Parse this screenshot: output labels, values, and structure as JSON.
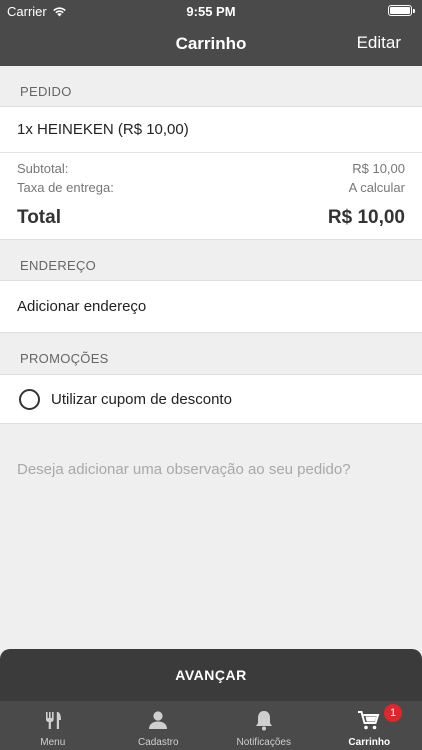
{
  "status_bar": {
    "carrier": "Carrier",
    "time": "9:55 PM"
  },
  "nav": {
    "title": "Carrinho",
    "edit_label": "Editar"
  },
  "order": {
    "header": "PEDIDO",
    "item": "1x HEINEKEN  (R$ 10,00)",
    "subtotal_label": "Subtotal:",
    "subtotal_value": "R$ 10,00",
    "delivery_label": "Taxa de entrega:",
    "delivery_value": "A calcular",
    "total_label": "Total",
    "total_value": "R$ 10,00"
  },
  "address": {
    "header": "ENDEREÇO",
    "add_label": "Adicionar endereço"
  },
  "promotions": {
    "header": "PROMOÇÕES",
    "coupon_label": "Utilizar cupom de desconto"
  },
  "note": {
    "placeholder": "Deseja adicionar uma observação ao seu pedido?"
  },
  "advance_button": {
    "label": "AVANÇAR"
  },
  "tabs": [
    {
      "label": "Menu",
      "icon": "fork-knife-icon"
    },
    {
      "label": "Cadastro",
      "icon": "user-icon"
    },
    {
      "label": "Notificações",
      "icon": "bell-icon"
    },
    {
      "label": "Carrinho",
      "icon": "cart-icon",
      "badge": "1"
    }
  ],
  "colors": {
    "bar": "#4a4a4a",
    "badge": "#e0262b",
    "background": "#efefef"
  }
}
